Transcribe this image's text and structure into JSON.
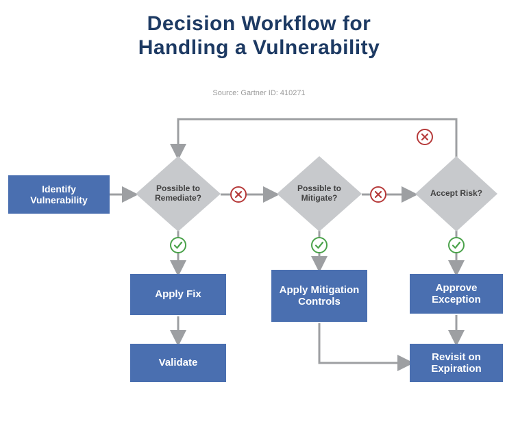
{
  "title_line1": "Decision Workflow for",
  "title_line2": "Handling a Vulnerability",
  "source_label": "Source: Gartner   ID: 410271",
  "nodes": {
    "identify": "Identify Vulnerability",
    "remediate_q": "Possible to Remediate?",
    "mitigate_q": "Possible to Mitigate?",
    "accept_q": "Accept Risk?",
    "apply_fix": "Apply Fix",
    "apply_mitigation": "Apply Mitigation Controls",
    "approve_exception": "Approve Exception",
    "validate": "Validate",
    "revisit": "Revisit on Expiration"
  },
  "colors": {
    "title": "#1d3a63",
    "box": "#4a6fb0",
    "diamond": "#c7c9cc",
    "arrow": "#9d9fa2",
    "yes": "#4aa24a",
    "no": "#b63a3a"
  },
  "icons": {
    "yes_name": "checkmark-icon",
    "no_name": "x-icon"
  }
}
